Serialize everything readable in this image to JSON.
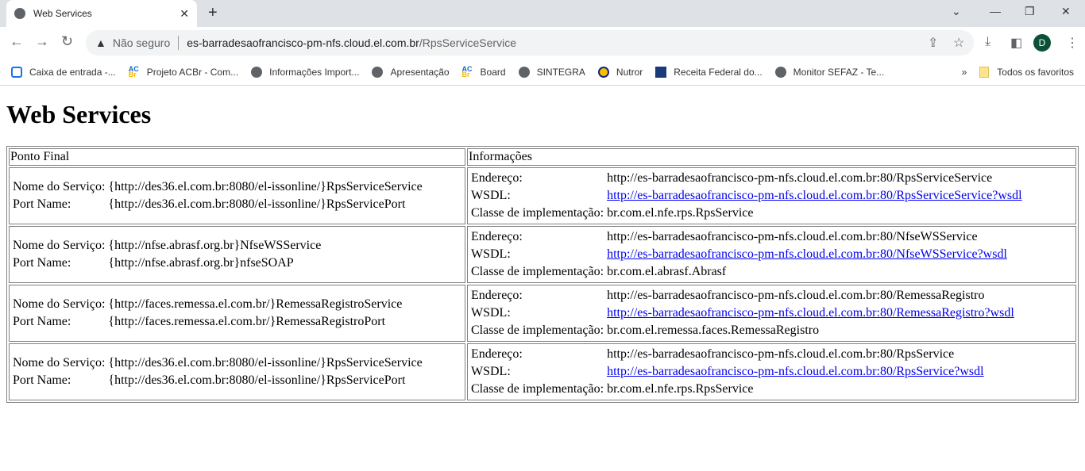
{
  "browser": {
    "tab_title": "Web Services",
    "security_label": "Não seguro",
    "url_host": "es-barradesaofrancisco-pm-nfs.cloud.el.com.br",
    "url_path": "/RpsServiceService",
    "avatar_letter": "D",
    "bookmarks": [
      {
        "label": "Caixa de entrada -...",
        "icon": "mail-icon"
      },
      {
        "label": "Projeto ACBr - Com...",
        "icon": "acbr-icon"
      },
      {
        "label": "Informações Import...",
        "icon": "globe-icon"
      },
      {
        "label": "Apresentação",
        "icon": "globe-icon"
      },
      {
        "label": "Board",
        "icon": "acbr-icon"
      },
      {
        "label": "SINTEGRA",
        "icon": "globe-icon"
      },
      {
        "label": "Nutror",
        "icon": "nutror-icon"
      },
      {
        "label": "Receita Federal do...",
        "icon": "receita-icon"
      },
      {
        "label": "Monitor SEFAZ - Te...",
        "icon": "globe-icon"
      }
    ],
    "all_bookmarks": "Todos os favoritos"
  },
  "page": {
    "title": "Web Services",
    "headers": [
      "Ponto Final",
      "Informações"
    ],
    "labels": {
      "service": "Nome do Serviço:",
      "port": "Port Name:",
      "address": "Endereço:",
      "wsdl": "WSDL:",
      "impl": "Classe de implementação:"
    },
    "rows": [
      {
        "service": "{http://des36.el.com.br:8080/el-issonline/}RpsServiceService",
        "port": "{http://des36.el.com.br:8080/el-issonline/}RpsServicePort",
        "address": "http://es-barradesaofrancisco-pm-nfs.cloud.el.com.br:80/RpsServiceService",
        "wsdl": "http://es-barradesaofrancisco-pm-nfs.cloud.el.com.br:80/RpsServiceService?wsdl",
        "impl": "br.com.el.nfe.rps.RpsService"
      },
      {
        "service": "{http://nfse.abrasf.org.br}NfseWSService",
        "port": "{http://nfse.abrasf.org.br}nfseSOAP",
        "address": "http://es-barradesaofrancisco-pm-nfs.cloud.el.com.br:80/NfseWSService",
        "wsdl": "http://es-barradesaofrancisco-pm-nfs.cloud.el.com.br:80/NfseWSService?wsdl",
        "impl": "br.com.el.abrasf.Abrasf"
      },
      {
        "service": "{http://faces.remessa.el.com.br/}RemessaRegistroService",
        "port": "{http://faces.remessa.el.com.br/}RemessaRegistroPort",
        "address": "http://es-barradesaofrancisco-pm-nfs.cloud.el.com.br:80/RemessaRegistro",
        "wsdl": "http://es-barradesaofrancisco-pm-nfs.cloud.el.com.br:80/RemessaRegistro?wsdl",
        "impl": "br.com.el.remessa.faces.RemessaRegistro"
      },
      {
        "service": "{http://des36.el.com.br:8080/el-issonline/}RpsServiceService",
        "port": "{http://des36.el.com.br:8080/el-issonline/}RpsServicePort",
        "address": "http://es-barradesaofrancisco-pm-nfs.cloud.el.com.br:80/RpsService",
        "wsdl": "http://es-barradesaofrancisco-pm-nfs.cloud.el.com.br:80/RpsService?wsdl",
        "impl": "br.com.el.nfe.rps.RpsService"
      }
    ]
  }
}
